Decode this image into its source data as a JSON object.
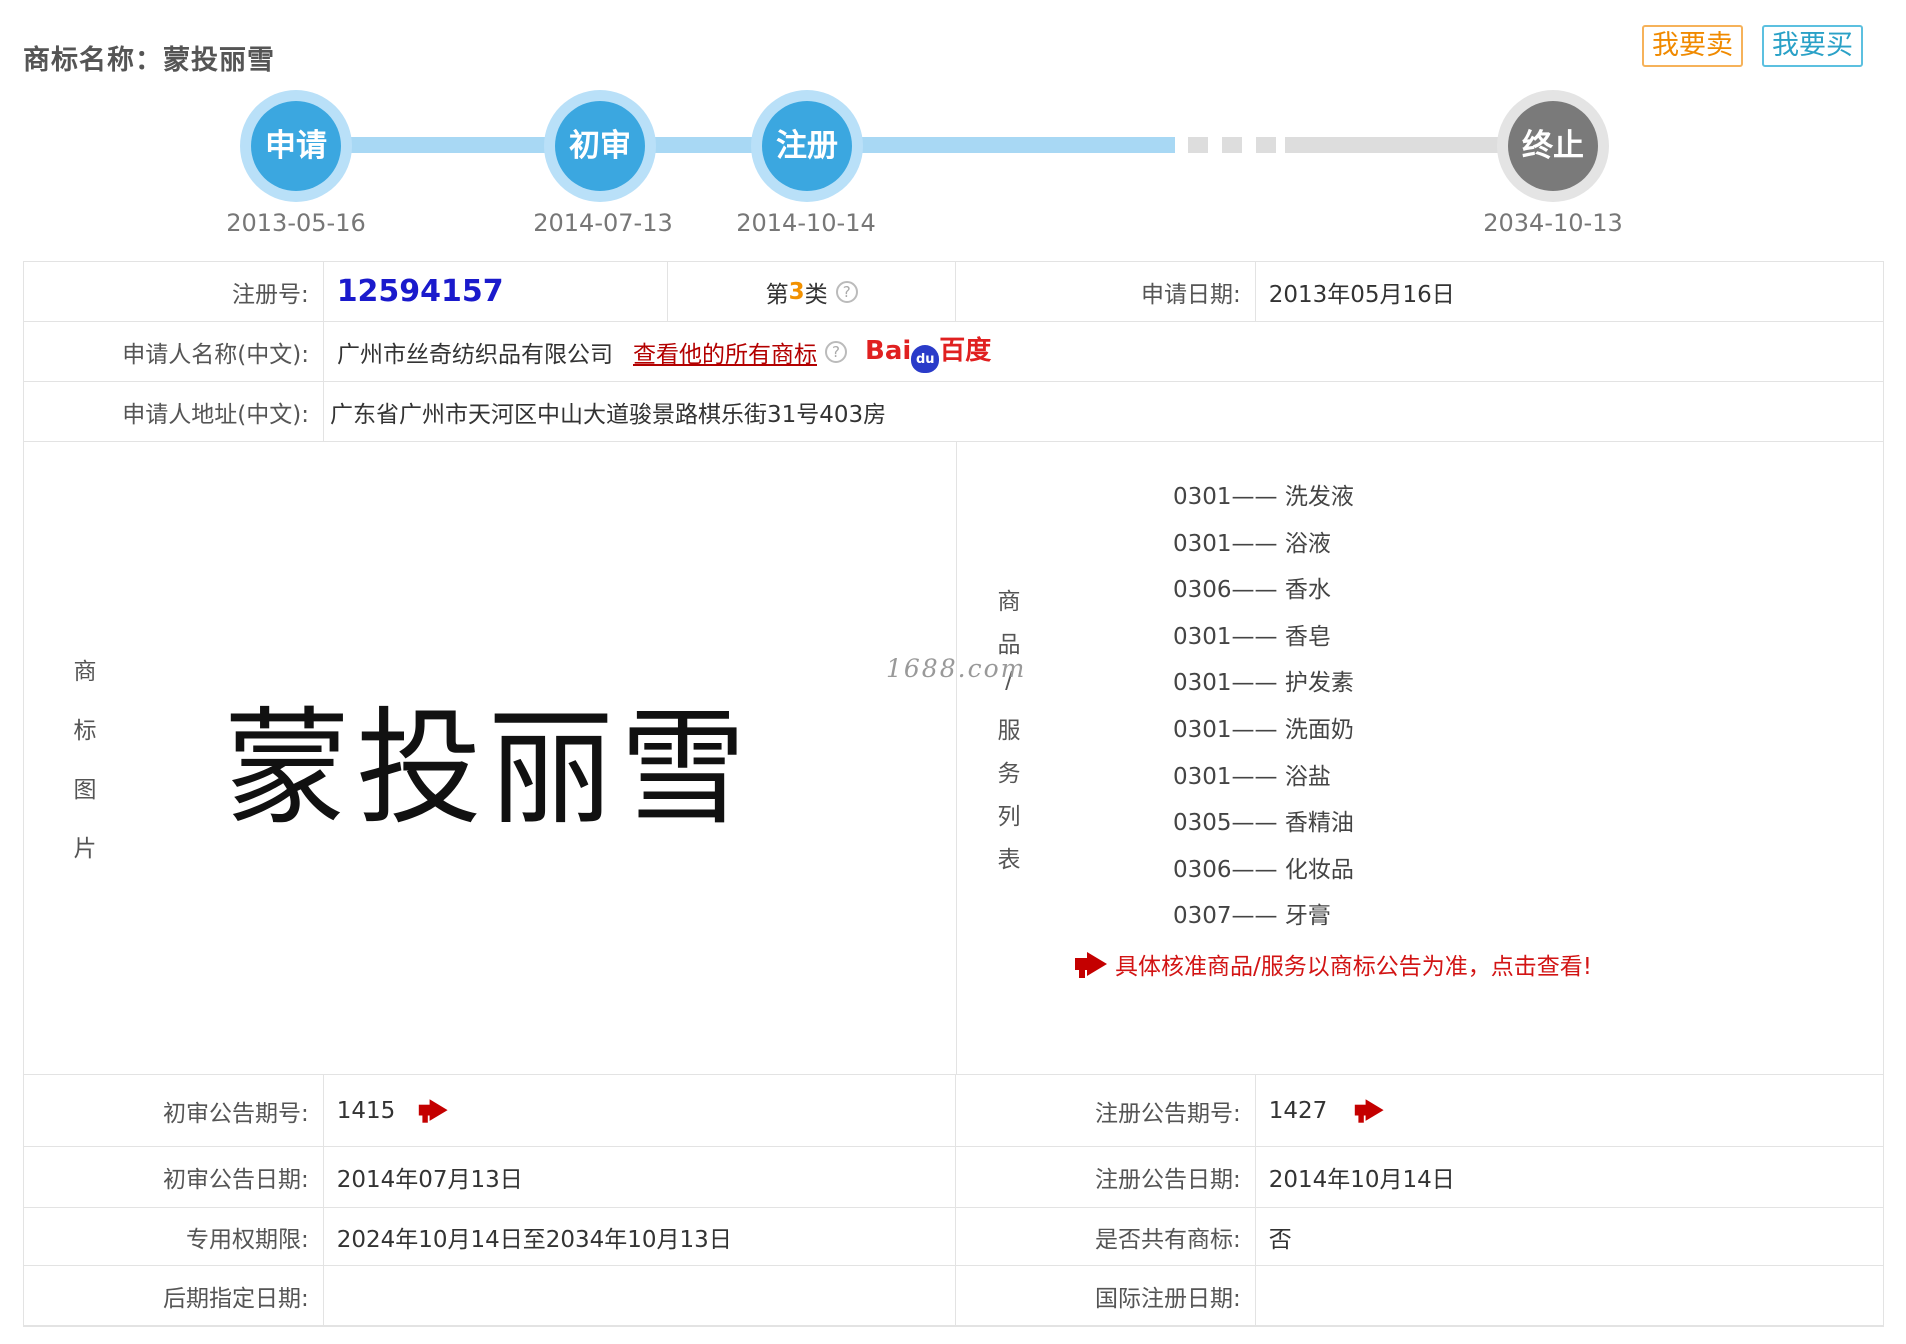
{
  "header": {
    "title": "商标名称：蒙投丽雪",
    "sell_label": "我要卖",
    "buy_label": "我要买"
  },
  "progress": {
    "steps": [
      {
        "label": "申请",
        "date": "2013-05-16"
      },
      {
        "label": "初审",
        "date": "2014-07-13"
      },
      {
        "label": "注册",
        "date": "2014-10-14"
      },
      {
        "label": "终止",
        "date": "2034-10-13"
      }
    ]
  },
  "info": {
    "reg_no_label": "注册号:",
    "reg_no": "12594157",
    "class_prefix": "第",
    "class_num": "3",
    "class_suffix": "类",
    "apply_date_label": "申请日期:",
    "apply_date": "2013年05月16日",
    "applicant_label": "申请人名称(中文):",
    "applicant": "广州市丝奇纺织品有限公司",
    "all_marks_link": "查看他的所有商标",
    "baidu_text": "Bai",
    "baidu_paw": "du",
    "baidu_suffix": "百度",
    "address_label": "申请人地址(中文):",
    "address": "广东省广州市天河区中山大道骏景路棋乐街31号403房"
  },
  "image_section": {
    "label_chars": [
      "商",
      "标",
      "图",
      "片"
    ],
    "mark_text": "蒙投丽雪",
    "watermark": "1688.com",
    "goods_label_chars": [
      "商",
      "品",
      "/",
      "服",
      "务",
      "列",
      "表"
    ],
    "goods": [
      "0301—— 洗发液",
      "0301—— 浴液",
      "0306—— 香水",
      "0301—— 香皂",
      "0301—— 护发素",
      "0301—— 洗面奶",
      "0301—— 浴盐",
      "0305—— 香精油",
      "0306—— 化妆品",
      "0307—— 牙膏"
    ],
    "notice": "具体核准商品/服务以商标公告为准，点击查看!"
  },
  "announcements": {
    "prelim_no_label": "初审公告期号:",
    "prelim_no": "1415",
    "reg_ann_no_label": "注册公告期号:",
    "reg_ann_no": "1427",
    "prelim_date_label": "初审公告日期:",
    "prelim_date": "2014年07月13日",
    "reg_ann_date_label": "注册公告日期:",
    "reg_ann_date": "2014年10月14日",
    "exclusive_label": "专用权期限:",
    "exclusive": "2024年10月14日至2034年10月13日",
    "shared_label": "是否共有商标:",
    "shared": "否",
    "later_label": "后期指定日期:",
    "later": "",
    "intl_label": "国际注册日期:",
    "intl": ""
  },
  "colors": {
    "step_blue": "#3ba7e0",
    "step_gray": "#7a7a7a",
    "reg_no": "#1a1acc",
    "notice_red": "#d21414",
    "sell_orange": "#f08a00",
    "buy_teal": "#2aa1c7"
  }
}
